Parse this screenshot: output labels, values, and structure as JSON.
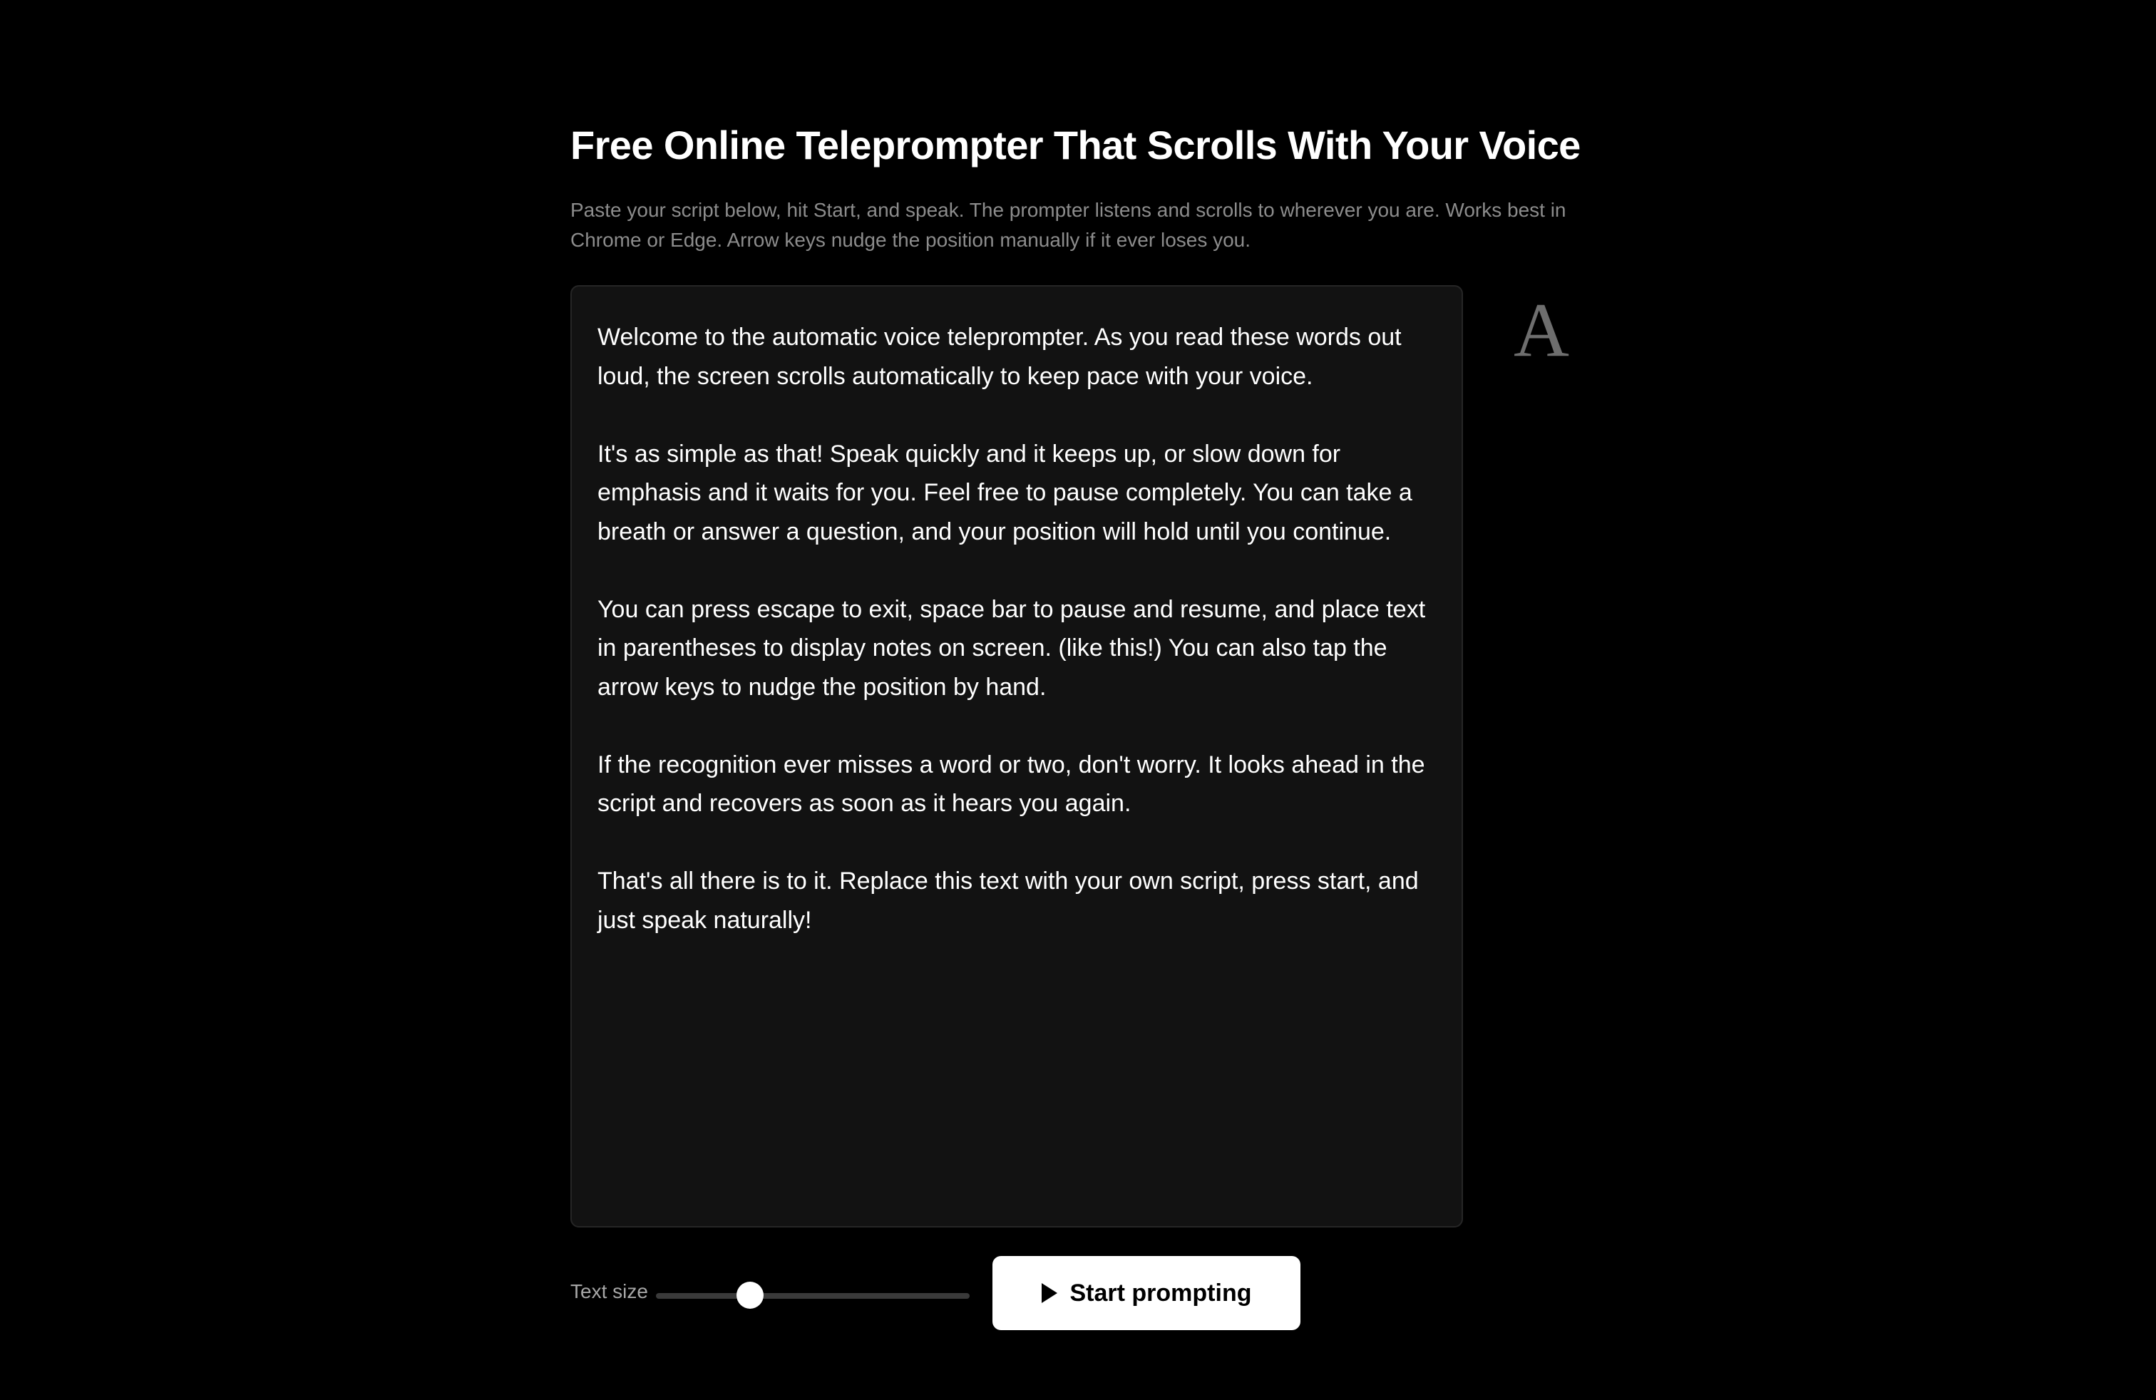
{
  "header": {
    "title": "Free Online Teleprompter That Scrolls With Your Voice",
    "description": "Paste your script below, hit Start, and speak. The prompter listens and scrolls to wherever you are. Works best in Chrome or Edge. Arrow keys nudge the position manually if it ever loses you."
  },
  "editor": {
    "paragraphs": [
      "Welcome to the automatic voice teleprompter. As you read these words out loud, the screen scrolls automatically to keep pace with your voice.",
      "It's as simple as that! Speak quickly and it keeps up, or slow down for emphasis and it waits for you. Feel free to pause completely. You can take a breath or answer a question, and your position will hold until you continue.",
      "You can press escape to exit, space bar to pause and resume, and place text in parentheses to display notes on screen. (like this!) You can also tap the arrow keys to nudge the position by hand.",
      "If the recognition ever misses a word or two, don't worry. It looks ahead in the script and recovers as soon as it hears you again.",
      "That's all there is to it. Replace this text with your own script, press start, and just speak naturally!"
    ]
  },
  "font_toggle": {
    "glyph": "A",
    "icon": "font-style-icon"
  },
  "controls": {
    "text_size_label": "Text size",
    "text_size_level": 0.3,
    "start_label": "Start prompting",
    "start_icon": "play-icon"
  },
  "colors": {
    "background": "#000000",
    "editor_background": "#121212",
    "editor_border": "#262626",
    "description_text": "#8c8c8c",
    "button_background": "#ffffff",
    "button_text": "#000000"
  }
}
